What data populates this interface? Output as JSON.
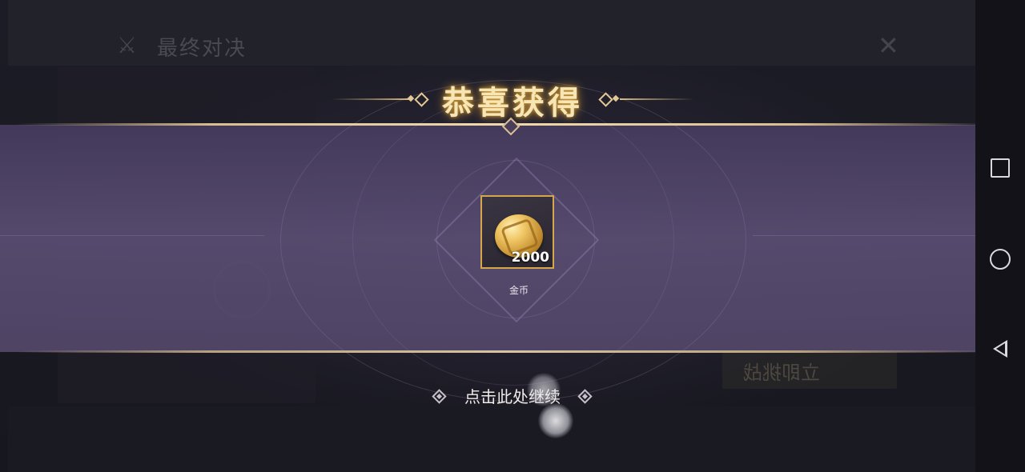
{
  "background": {
    "mode_title": "最终对决",
    "button_label_mirrored": "立即挑战"
  },
  "reward_popup": {
    "title": "恭喜获得",
    "item": {
      "icon": "gold-coin-icon",
      "count": "2000",
      "name": "金币"
    },
    "continue_label": "点击此处继续"
  },
  "system_nav": {
    "recent_icon": "square-icon",
    "home_icon": "circle-icon",
    "back_icon": "triangle-back-icon"
  },
  "colors": {
    "title_glow": "#e6aa3c",
    "item_border": "#d8a64a",
    "band": "#584c70"
  }
}
